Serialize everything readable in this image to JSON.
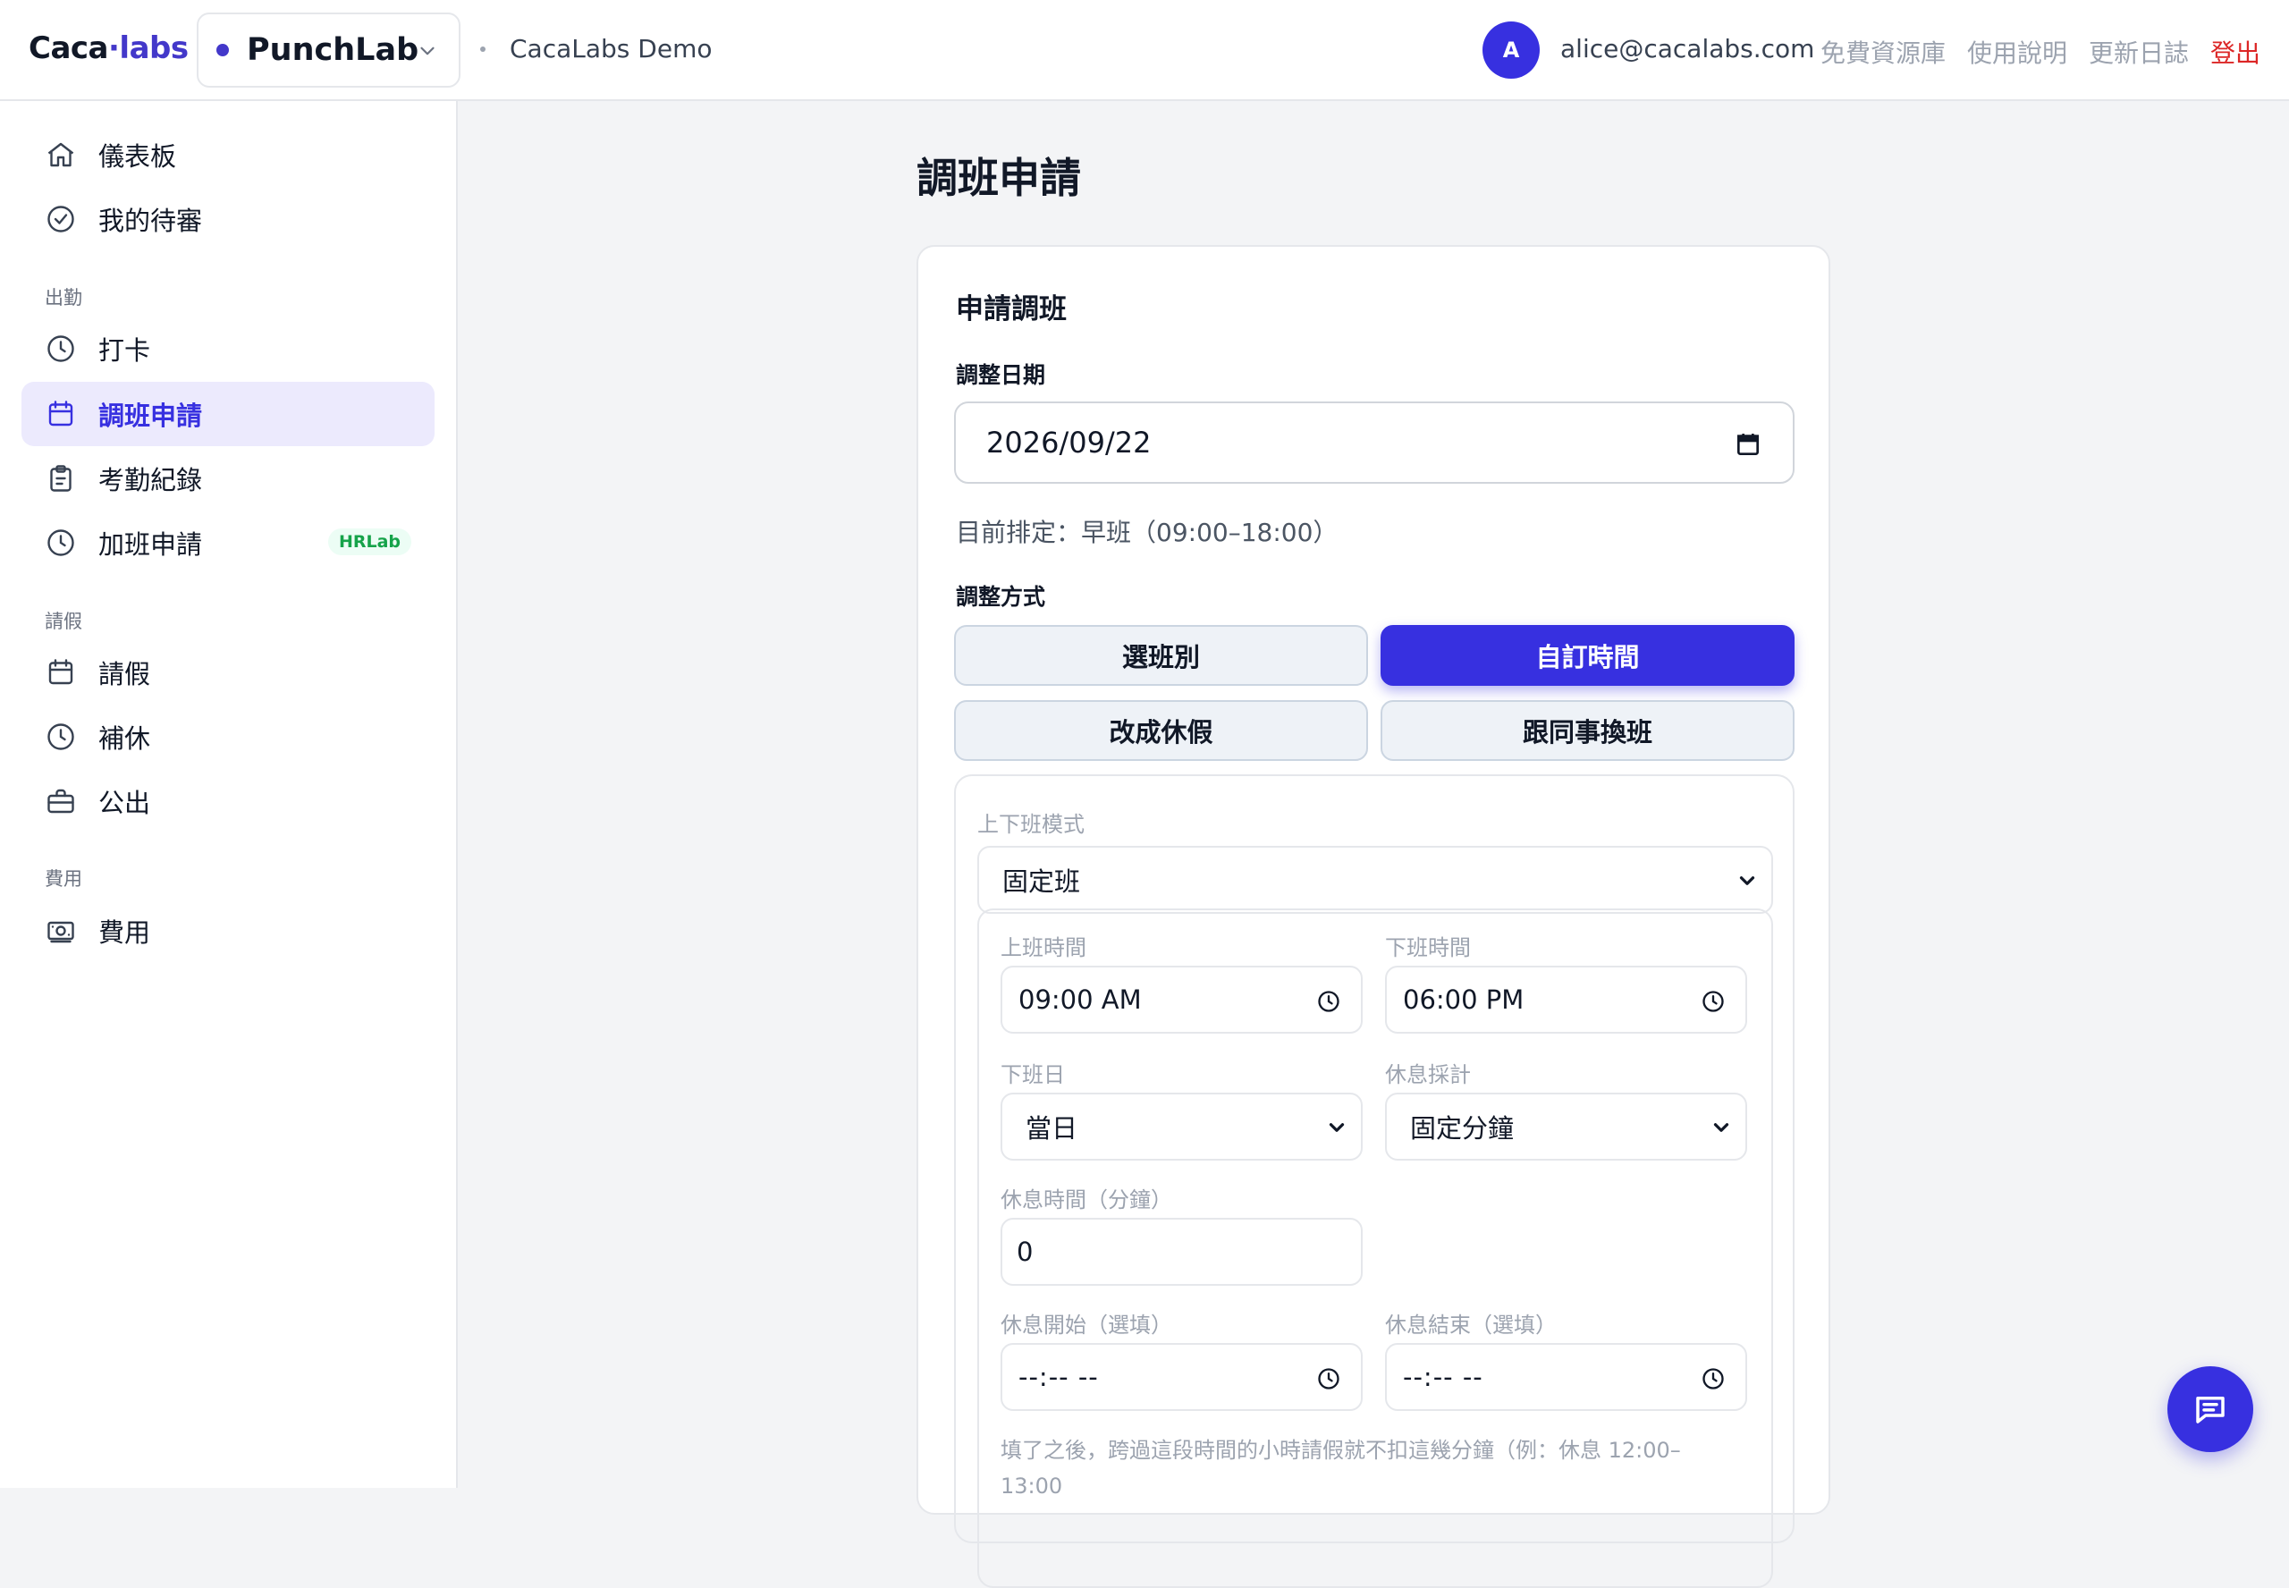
{
  "brand": {
    "logo_left": "Caca",
    "logo_dot": "·",
    "logo_right": "labs"
  },
  "product": {
    "name": "PunchLab"
  },
  "org": {
    "name": "CacaLabs Demo"
  },
  "user": {
    "avatar_initial": "A",
    "email": "alice@cacalabs.com"
  },
  "top_links": {
    "resources": "免費資源庫",
    "guide": "使用說明",
    "changelog": "更新日誌",
    "logout": "登出"
  },
  "sidebar": {
    "dashboard": "儀表板",
    "my_pending": "我的待審",
    "section_attendance": "出勤",
    "punch": "打卡",
    "shift_request": "調班申請",
    "attendance_records": "考勤紀錄",
    "overtime_request": "加班申請",
    "overtime_badge": "HRLab",
    "section_leave": "請假",
    "leave": "請假",
    "comp_time": "補休",
    "business_trip": "公出",
    "section_expense": "費用",
    "expense": "費用"
  },
  "page": {
    "title": "調班申請"
  },
  "form": {
    "card_title": "申請調班",
    "date_label": "調整日期",
    "date_value": "2026/09/22",
    "current_schedule": "目前排定：早班（09:00–18:00）",
    "mode_label": "調整方式",
    "modes": {
      "choose_shift": "選班別",
      "custom_time": "自訂時間",
      "change_to_leave": "改成休假",
      "swap_with_colleague": "跟同事換班"
    },
    "selected_mode": "custom_time",
    "work_mode_label": "上下班模式",
    "work_mode_value": "固定班",
    "start_time_label": "上班時間",
    "start_time_value": "09:00 AM",
    "end_time_label": "下班時間",
    "end_time_value": "06:00 PM",
    "end_day_label": "下班日",
    "end_day_value": "當日",
    "break_calc_label": "休息採計",
    "break_calc_value": "固定分鐘",
    "break_minutes_label": "休息時間（分鐘）",
    "break_minutes_value": "0",
    "break_start_label": "休息開始（選填）",
    "break_start_value": "--:-- --",
    "break_end_label": "休息結束（選填）",
    "break_end_value": "--:-- --",
    "hint": "填了之後，跨過這段時間的小時請假就不扣這幾分鐘（例：休息 12:00–13:00"
  },
  "colors": {
    "accent": "#3730e0",
    "logout": "#dc2626",
    "badge_green": "#16a34a"
  }
}
